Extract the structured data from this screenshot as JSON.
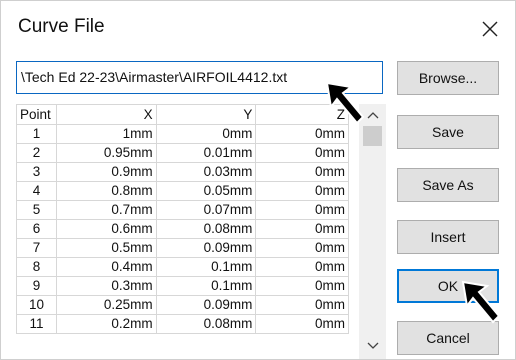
{
  "dialog": {
    "title": "Curve File",
    "file_path": "\\Tech Ed 22-23\\Airmaster\\AIRFOIL4412.txt"
  },
  "buttons": {
    "browse": "Browse...",
    "save": "Save",
    "save_as": "Save As",
    "insert": "Insert",
    "ok": "OK",
    "cancel": "Cancel"
  },
  "table": {
    "columns": [
      "Point",
      "X",
      "Y",
      "Z"
    ],
    "rows": [
      [
        "1",
        "1mm",
        "0mm",
        "0mm"
      ],
      [
        "2",
        "0.95mm",
        "0.01mm",
        "0mm"
      ],
      [
        "3",
        "0.9mm",
        "0.03mm",
        "0mm"
      ],
      [
        "4",
        "0.8mm",
        "0.05mm",
        "0mm"
      ],
      [
        "5",
        "0.7mm",
        "0.07mm",
        "0mm"
      ],
      [
        "6",
        "0.6mm",
        "0.08mm",
        "0mm"
      ],
      [
        "7",
        "0.5mm",
        "0.09mm",
        "0mm"
      ],
      [
        "8",
        "0.4mm",
        "0.1mm",
        "0mm"
      ],
      [
        "9",
        "0.3mm",
        "0.1mm",
        "0mm"
      ],
      [
        "10",
        "0.25mm",
        "0.09mm",
        "0mm"
      ],
      [
        "11",
        "0.2mm",
        "0.08mm",
        "0mm"
      ]
    ]
  },
  "colors": {
    "accent": "#0078d7",
    "button_bg": "#e1e1e1",
    "grid_line": "#d7d7d7",
    "scrollbar_bg": "#f0f0f0"
  },
  "icons": {
    "close": "close-icon",
    "scroll_up": "chevron-up-icon",
    "scroll_down": "chevron-down-icon",
    "pointer": "mouse-pointer-icon"
  }
}
